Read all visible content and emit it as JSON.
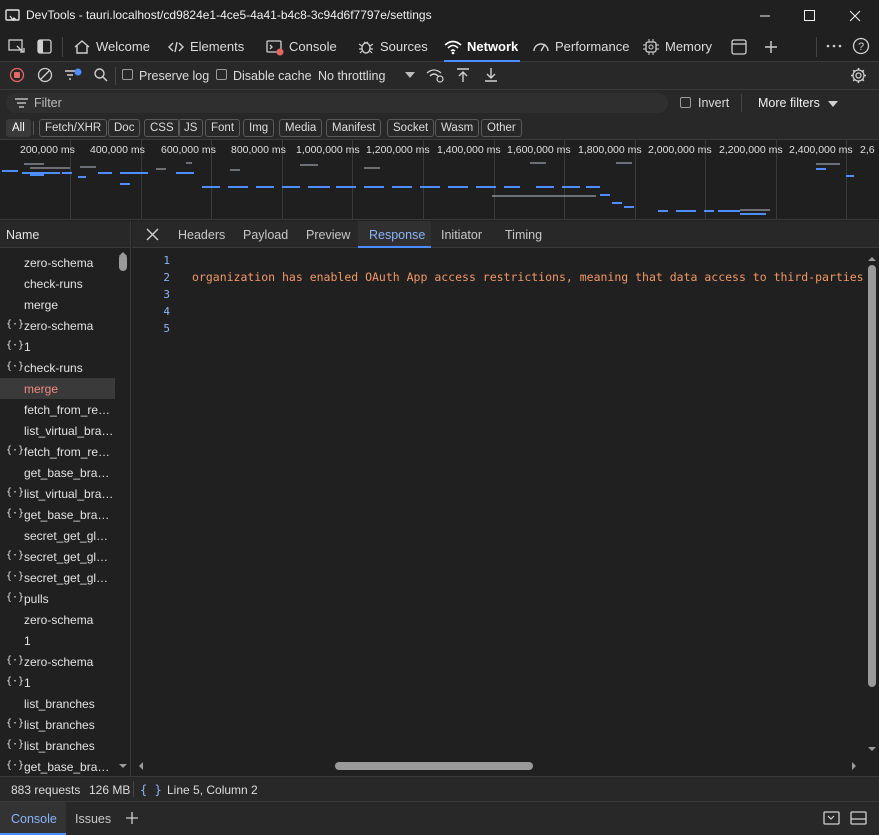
{
  "window": {
    "title": "DevTools - tauri.localhost/cd9824e1-4ce5-4a41-b4c8-3c94d6f7797e/settings"
  },
  "main_tabs": [
    {
      "label": "Welcome",
      "icon": "home-icon"
    },
    {
      "label": "Elements",
      "icon": "code-icon"
    },
    {
      "label": "Console",
      "icon": "console-icon"
    },
    {
      "label": "Sources",
      "icon": "bug-icon"
    },
    {
      "label": "Network",
      "icon": "wifi-icon",
      "active": true
    },
    {
      "label": "Performance",
      "icon": "gauge-icon"
    },
    {
      "label": "Memory",
      "icon": "chip-icon"
    }
  ],
  "toolbar": {
    "preserve_log": "Preserve log",
    "disable_cache": "Disable cache",
    "throttling": "No throttling"
  },
  "filter": {
    "placeholder": "Filter",
    "invert": "Invert",
    "more_filters": "More filters"
  },
  "type_filters": [
    "All",
    "Fetch/XHR",
    "Doc",
    "CSS",
    "JS",
    "Font",
    "Img",
    "Media",
    "Manifest",
    "Socket",
    "Wasm",
    "Other"
  ],
  "overview": {
    "ticks": [
      "200,000 ms",
      "400,000 ms",
      "600,000 ms",
      "800,000 ms",
      "1,000,000 ms",
      "1,200,000 ms",
      "1,400,000 ms",
      "1,600,000 ms",
      "1,800,000 ms",
      "2,000,000 ms",
      "2,200,000 ms",
      "2,400,000 ms",
      "2,6"
    ]
  },
  "name_column": {
    "header": "Name",
    "rows": [
      {
        "name": "zero-schema",
        "fetch": false
      },
      {
        "name": "check-runs",
        "fetch": false
      },
      {
        "name": "merge",
        "fetch": false
      },
      {
        "name": "zero-schema",
        "fetch": true
      },
      {
        "name": "1",
        "fetch": true
      },
      {
        "name": "check-runs",
        "fetch": true
      },
      {
        "name": "merge",
        "fetch": false,
        "selected": true
      },
      {
        "name": "fetch_from_remote",
        "fetch": false
      },
      {
        "name": "list_virtual_branches",
        "fetch": false
      },
      {
        "name": "fetch_from_remote",
        "fetch": true
      },
      {
        "name": "get_base_branch_data",
        "fetch": false
      },
      {
        "name": "list_virtual_branches",
        "fetch": true
      },
      {
        "name": "get_base_branch_data",
        "fetch": true
      },
      {
        "name": "secret_get_global",
        "fetch": false
      },
      {
        "name": "secret_get_global",
        "fetch": true
      },
      {
        "name": "secret_get_global",
        "fetch": true
      },
      {
        "name": "pulls",
        "fetch": true
      },
      {
        "name": "zero-schema",
        "fetch": false
      },
      {
        "name": "1",
        "fetch": false
      },
      {
        "name": "zero-schema",
        "fetch": true
      },
      {
        "name": "1",
        "fetch": true
      },
      {
        "name": "list_branches",
        "fetch": false
      },
      {
        "name": "list_branches",
        "fetch": true
      },
      {
        "name": "list_branches",
        "fetch": true
      },
      {
        "name": "get_base_branch_data",
        "fetch": true
      }
    ]
  },
  "detail_tabs": [
    "Headers",
    "Payload",
    "Preview",
    "Response",
    "Initiator",
    "Timing"
  ],
  "active_detail_tab": "Response",
  "response": {
    "line_numbers": [
      "1",
      "2",
      "3",
      "4",
      "5"
    ],
    "line2": "organization has enabled OAuth App access restrictions, meaning that data access to third-parties is limited"
  },
  "status": {
    "requests": "883 requests",
    "size": "126 MB",
    "format_icon": "{ }",
    "cursor": "Line 5, Column 2"
  },
  "drawer": {
    "tabs": [
      "Console",
      "Issues"
    ]
  },
  "colors": {
    "accent": "#4c8dff",
    "record": "#e46962",
    "response_text": "#f29766",
    "line_number": "#8ab4f8"
  }
}
